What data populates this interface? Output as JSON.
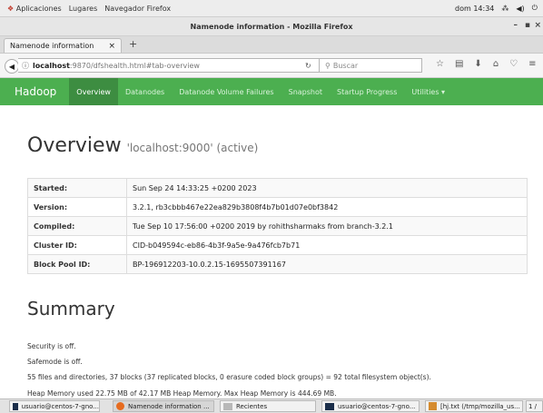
{
  "os_bar": {
    "applications": "Aplicaciones",
    "places": "Lugares",
    "browser": "Navegador Firefox",
    "clock": "dom 14:34"
  },
  "window": {
    "title": "Namenode information - Mozilla Firefox"
  },
  "tab": {
    "label": "Namenode information"
  },
  "address": {
    "host": "localhost",
    "rest": ":9870/dfshealth.html#tab-overview",
    "search_placeholder": "Buscar"
  },
  "hadoop_nav": {
    "brand": "Hadoop",
    "items": [
      "Overview",
      "Datanodes",
      "Datanode Volume Failures",
      "Snapshot",
      "Startup Progress",
      "Utilities ▾"
    ]
  },
  "overview": {
    "title": "Overview",
    "subtitle": "'localhost:9000' (active)",
    "rows": [
      {
        "k": "Started:",
        "v": "Sun Sep 24 14:33:25 +0200 2023"
      },
      {
        "k": "Version:",
        "v": "3.2.1, rb3cbbb467e22ea829b3808f4b7b01d07e0bf3842"
      },
      {
        "k": "Compiled:",
        "v": "Tue Sep 10 17:56:00 +0200 2019 by rohithsharmaks from branch-3.2.1"
      },
      {
        "k": "Cluster ID:",
        "v": "CID-b049594c-eb86-4b3f-9a5e-9a476fcb7b71"
      },
      {
        "k": "Block Pool ID:",
        "v": "BP-196912203-10.0.2.15-1695507391167"
      }
    ]
  },
  "summary": {
    "title": "Summary",
    "lines": [
      "Security is off.",
      "Safemode is off.",
      "55 files and directories, 37 blocks (37 replicated blocks, 0 erasure coded block groups) = 92 total filesystem object(s).",
      "Heap Memory used 22.75 MB of 42.17 MB Heap Memory. Max Heap Memory is 444.69 MB."
    ]
  },
  "taskbar": {
    "items": [
      "usuario@centos-7-gno...",
      "Namenode information ...",
      "Recientes",
      "usuario@centos-7-gno...",
      "[hj.txt (/tmp/mozilla_us...",
      "1 /"
    ]
  }
}
